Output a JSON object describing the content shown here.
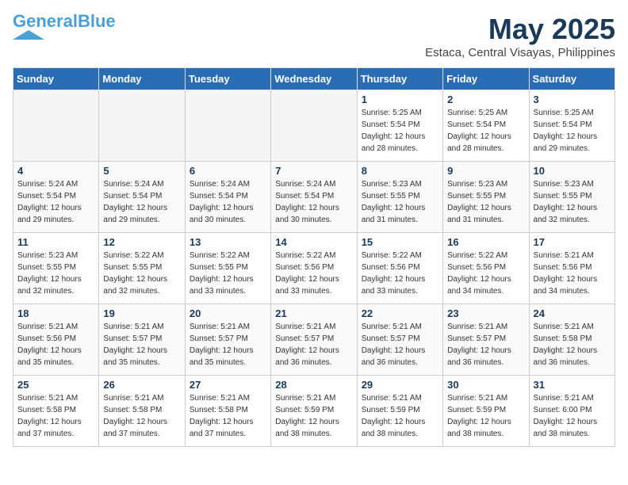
{
  "logo": {
    "line1": "General",
    "line2": "Blue",
    "tagline": ""
  },
  "title": "May 2025",
  "subtitle": "Estaca, Central Visayas, Philippines",
  "weekdays": [
    "Sunday",
    "Monday",
    "Tuesday",
    "Wednesday",
    "Thursday",
    "Friday",
    "Saturday"
  ],
  "weeks": [
    [
      {
        "day": "",
        "info": ""
      },
      {
        "day": "",
        "info": ""
      },
      {
        "day": "",
        "info": ""
      },
      {
        "day": "",
        "info": ""
      },
      {
        "day": "1",
        "info": "Sunrise: 5:25 AM\nSunset: 5:54 PM\nDaylight: 12 hours\nand 28 minutes."
      },
      {
        "day": "2",
        "info": "Sunrise: 5:25 AM\nSunset: 5:54 PM\nDaylight: 12 hours\nand 28 minutes."
      },
      {
        "day": "3",
        "info": "Sunrise: 5:25 AM\nSunset: 5:54 PM\nDaylight: 12 hours\nand 29 minutes."
      }
    ],
    [
      {
        "day": "4",
        "info": "Sunrise: 5:24 AM\nSunset: 5:54 PM\nDaylight: 12 hours\nand 29 minutes."
      },
      {
        "day": "5",
        "info": "Sunrise: 5:24 AM\nSunset: 5:54 PM\nDaylight: 12 hours\nand 29 minutes."
      },
      {
        "day": "6",
        "info": "Sunrise: 5:24 AM\nSunset: 5:54 PM\nDaylight: 12 hours\nand 30 minutes."
      },
      {
        "day": "7",
        "info": "Sunrise: 5:24 AM\nSunset: 5:54 PM\nDaylight: 12 hours\nand 30 minutes."
      },
      {
        "day": "8",
        "info": "Sunrise: 5:23 AM\nSunset: 5:55 PM\nDaylight: 12 hours\nand 31 minutes."
      },
      {
        "day": "9",
        "info": "Sunrise: 5:23 AM\nSunset: 5:55 PM\nDaylight: 12 hours\nand 31 minutes."
      },
      {
        "day": "10",
        "info": "Sunrise: 5:23 AM\nSunset: 5:55 PM\nDaylight: 12 hours\nand 32 minutes."
      }
    ],
    [
      {
        "day": "11",
        "info": "Sunrise: 5:23 AM\nSunset: 5:55 PM\nDaylight: 12 hours\nand 32 minutes."
      },
      {
        "day": "12",
        "info": "Sunrise: 5:22 AM\nSunset: 5:55 PM\nDaylight: 12 hours\nand 32 minutes."
      },
      {
        "day": "13",
        "info": "Sunrise: 5:22 AM\nSunset: 5:55 PM\nDaylight: 12 hours\nand 33 minutes."
      },
      {
        "day": "14",
        "info": "Sunrise: 5:22 AM\nSunset: 5:56 PM\nDaylight: 12 hours\nand 33 minutes."
      },
      {
        "day": "15",
        "info": "Sunrise: 5:22 AM\nSunset: 5:56 PM\nDaylight: 12 hours\nand 33 minutes."
      },
      {
        "day": "16",
        "info": "Sunrise: 5:22 AM\nSunset: 5:56 PM\nDaylight: 12 hours\nand 34 minutes."
      },
      {
        "day": "17",
        "info": "Sunrise: 5:21 AM\nSunset: 5:56 PM\nDaylight: 12 hours\nand 34 minutes."
      }
    ],
    [
      {
        "day": "18",
        "info": "Sunrise: 5:21 AM\nSunset: 5:56 PM\nDaylight: 12 hours\nand 35 minutes."
      },
      {
        "day": "19",
        "info": "Sunrise: 5:21 AM\nSunset: 5:57 PM\nDaylight: 12 hours\nand 35 minutes."
      },
      {
        "day": "20",
        "info": "Sunrise: 5:21 AM\nSunset: 5:57 PM\nDaylight: 12 hours\nand 35 minutes."
      },
      {
        "day": "21",
        "info": "Sunrise: 5:21 AM\nSunset: 5:57 PM\nDaylight: 12 hours\nand 36 minutes."
      },
      {
        "day": "22",
        "info": "Sunrise: 5:21 AM\nSunset: 5:57 PM\nDaylight: 12 hours\nand 36 minutes."
      },
      {
        "day": "23",
        "info": "Sunrise: 5:21 AM\nSunset: 5:57 PM\nDaylight: 12 hours\nand 36 minutes."
      },
      {
        "day": "24",
        "info": "Sunrise: 5:21 AM\nSunset: 5:58 PM\nDaylight: 12 hours\nand 36 minutes."
      }
    ],
    [
      {
        "day": "25",
        "info": "Sunrise: 5:21 AM\nSunset: 5:58 PM\nDaylight: 12 hours\nand 37 minutes."
      },
      {
        "day": "26",
        "info": "Sunrise: 5:21 AM\nSunset: 5:58 PM\nDaylight: 12 hours\nand 37 minutes."
      },
      {
        "day": "27",
        "info": "Sunrise: 5:21 AM\nSunset: 5:58 PM\nDaylight: 12 hours\nand 37 minutes."
      },
      {
        "day": "28",
        "info": "Sunrise: 5:21 AM\nSunset: 5:59 PM\nDaylight: 12 hours\nand 38 minutes."
      },
      {
        "day": "29",
        "info": "Sunrise: 5:21 AM\nSunset: 5:59 PM\nDaylight: 12 hours\nand 38 minutes."
      },
      {
        "day": "30",
        "info": "Sunrise: 5:21 AM\nSunset: 5:59 PM\nDaylight: 12 hours\nand 38 minutes."
      },
      {
        "day": "31",
        "info": "Sunrise: 5:21 AM\nSunset: 6:00 PM\nDaylight: 12 hours\nand 38 minutes."
      }
    ]
  ]
}
